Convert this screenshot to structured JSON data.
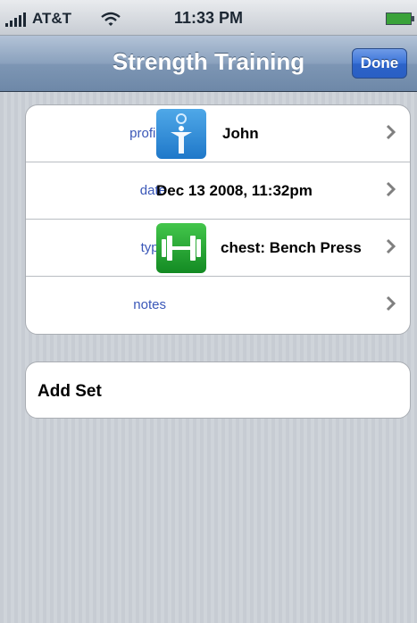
{
  "status_bar": {
    "carrier": "AT&T",
    "time": "11:33 PM"
  },
  "nav": {
    "title": "Strength Training",
    "done_label": "Done"
  },
  "form": {
    "rows": [
      {
        "label": "profile",
        "value": "John",
        "icon": "profile-person-icon"
      },
      {
        "label": "date",
        "value": "Dec 13 2008, 11:32pm"
      },
      {
        "label": "type",
        "value": "chest: Bench Press",
        "icon": "dumbbell-icon"
      },
      {
        "label": "notes",
        "value": ""
      }
    ]
  },
  "add_set": {
    "label": "Add Set"
  },
  "colors": {
    "navbar": "#7d96b4",
    "done_button": "#3a73d9",
    "field_label": "#3a57b8",
    "background_stripe": "#c7ccd3"
  }
}
